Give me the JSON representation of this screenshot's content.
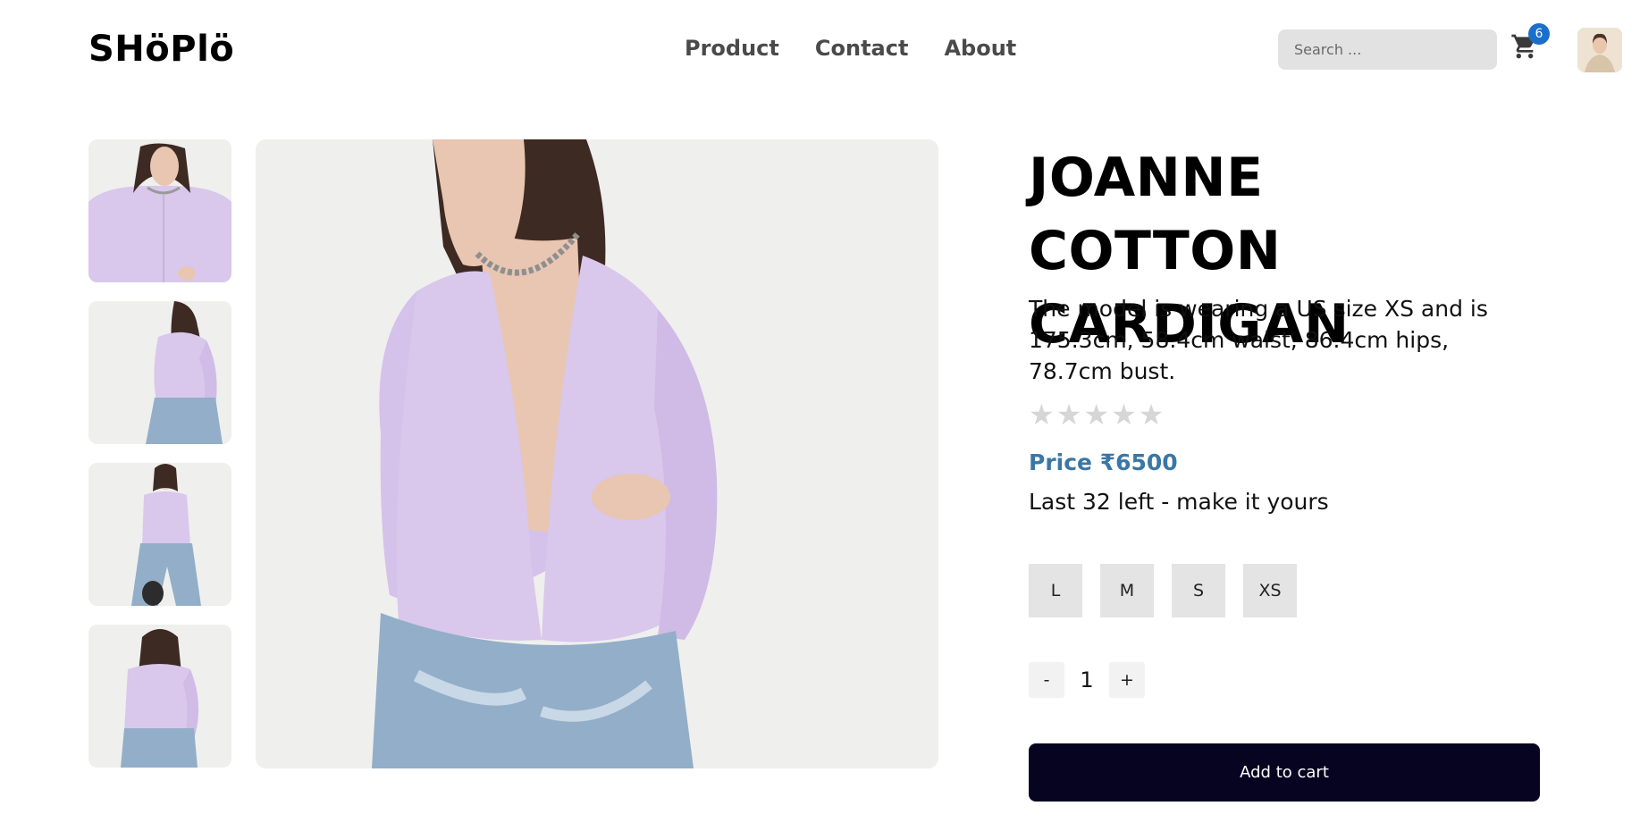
{
  "header": {
    "logo": "SHöPlö",
    "nav": [
      "Product",
      "Contact",
      "About"
    ],
    "search_placeholder": "Search ...",
    "cart_count": "6"
  },
  "product": {
    "title": "JOANNE COTTON CARDIGAN",
    "description": "The model is wearing a US size XS and is 175.3cm, 58.4cm waist, 86.4cm hips, 78.7cm bust.",
    "rating": 0,
    "rating_max": 5,
    "price": "Price ₹6500",
    "stock": "Last 32 left - make it yours",
    "sizes": [
      "L",
      "M",
      "S",
      "XS"
    ],
    "quantity": "1",
    "qty_minus": "-",
    "qty_plus": "+",
    "add_to_cart": "Add to cart"
  },
  "colors": {
    "accent": "#3a77a6",
    "badge": "#1a6fc9",
    "cta": "#060421",
    "cardigan": "#d9c7ec"
  },
  "icons": {
    "cart": "cart-icon",
    "star": "star-icon"
  }
}
